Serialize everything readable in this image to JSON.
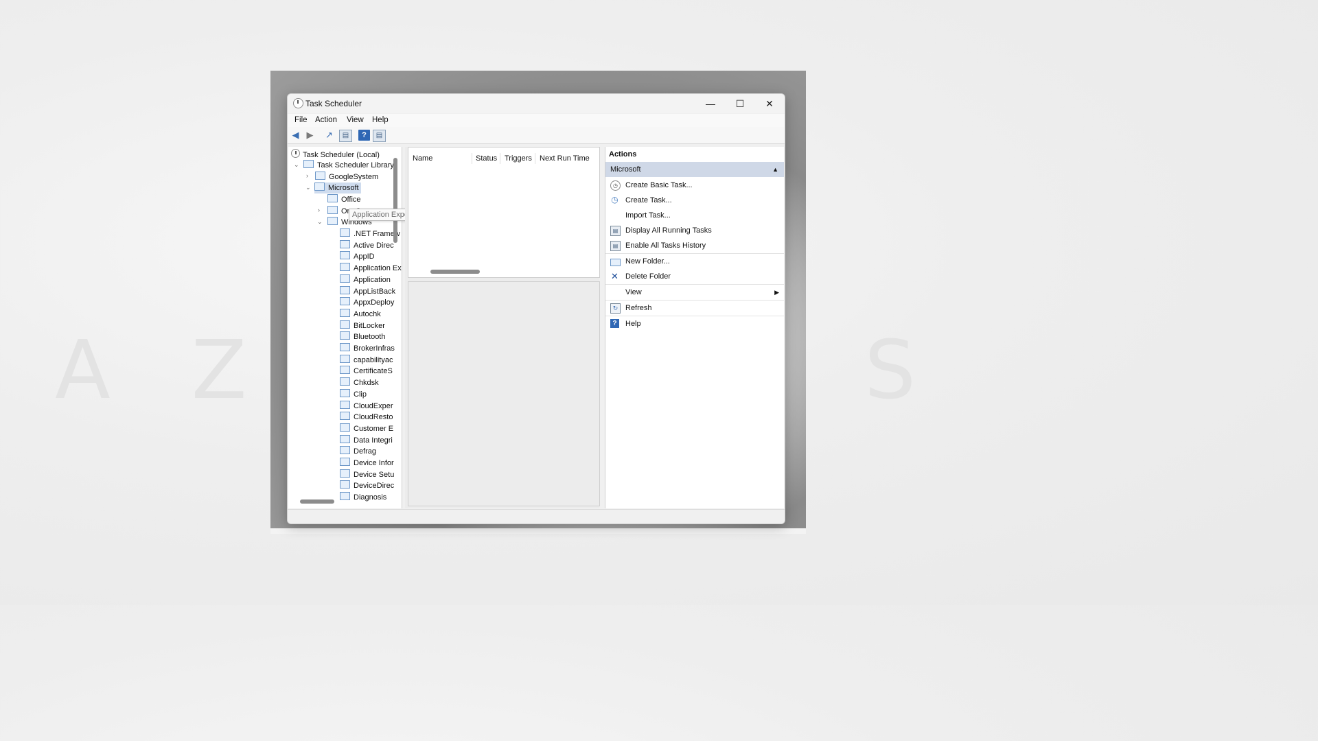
{
  "window": {
    "title": "Task Scheduler",
    "controls": {
      "minimize": "—",
      "maximize": "☐",
      "close": "✕"
    }
  },
  "menubar": [
    "File",
    "Action",
    "View",
    "Help"
  ],
  "toolbar": {
    "icons": [
      "back-arrow-icon",
      "forward-arrow-icon",
      "up-folder-icon",
      "show-hide-console-tree-icon",
      "help-icon",
      "show-hide-action-pane-icon"
    ]
  },
  "tree": {
    "root": "Task Scheduler (Local)",
    "library": "Task Scheduler Library",
    "google": "GoogleSystem",
    "microsoft": "Microsoft",
    "office": "Office",
    "onecore": "OneCore",
    "windows": "Windows",
    "windows_children": [
      ".NET Framew",
      "Active Direc",
      "AppID",
      "Application Experience",
      "Application",
      "AppListBack",
      "AppxDeploy",
      "Autochk",
      "BitLocker",
      "Bluetooth",
      "BrokerInfras",
      "capabilityac",
      "CertificateS",
      "Chkdsk",
      "Clip",
      "CloudExper",
      "CloudResto",
      "Customer E",
      "Data Integri",
      "Defrag",
      "Device Infor",
      "Device Setu",
      "DeviceDirec",
      "Diagnosis"
    ],
    "tooltip": "Application Experience"
  },
  "list": {
    "columns": [
      "Name",
      "Status",
      "Triggers",
      "Next Run Time"
    ]
  },
  "actions": {
    "header": "Actions",
    "group": "Microsoft",
    "items": [
      {
        "label": "Create Basic Task...",
        "icon": "create-basic-task-icon"
      },
      {
        "label": "Create Task...",
        "icon": "create-task-icon"
      },
      {
        "label": "Import Task...",
        "icon": ""
      },
      {
        "label": "Display All Running Tasks",
        "icon": "running-tasks-icon"
      },
      {
        "label": "Enable All Tasks History",
        "icon": "tasks-history-icon"
      },
      {
        "label": "New Folder...",
        "icon": "new-folder-icon"
      },
      {
        "label": "Delete Folder",
        "icon": "delete-icon"
      },
      {
        "label": "View",
        "icon": ""
      },
      {
        "label": "Refresh",
        "icon": "refresh-icon"
      },
      {
        "label": "Help",
        "icon": "help-icon"
      }
    ]
  },
  "colors": {
    "selection": "#cfd8e7",
    "accent": "#2f67b4",
    "delete": "#1f4f9a"
  }
}
